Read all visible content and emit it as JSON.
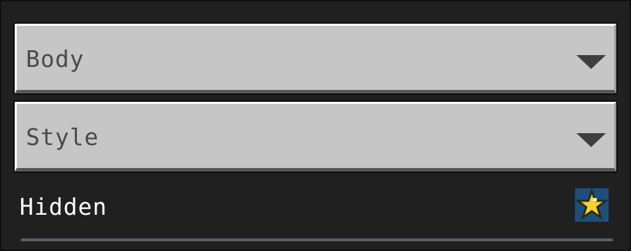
{
  "dropdowns": [
    {
      "label": "Body"
    },
    {
      "label": "Style"
    }
  ],
  "hidden_row": {
    "label": "Hidden",
    "icon": "star-icon",
    "icon_colors": {
      "background": "#1e4f7a",
      "star": "#f2d330",
      "outline": "#2b2b1a"
    }
  }
}
